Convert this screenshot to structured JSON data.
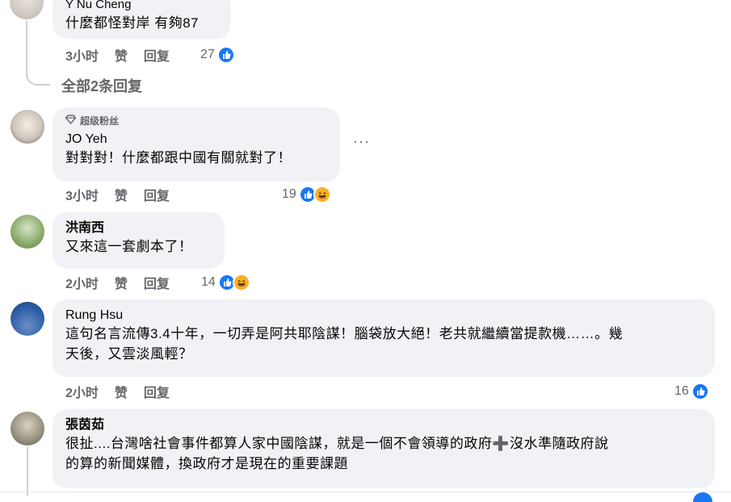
{
  "comments": [
    {
      "author": "Y Nu Cheng",
      "text": "什麼都怪對岸 有夠87",
      "time": "3小时",
      "like_label": "赞",
      "reply_label": "回复",
      "reaction_count": "27",
      "reactions": [
        "like"
      ]
    },
    {
      "author": "JO Yeh",
      "badge": "超级粉丝",
      "badge_icon": "diamond-icon",
      "text": "對對對！什麼都跟中國有關就對了！",
      "time": "3小时",
      "like_label": "赞",
      "reply_label": "回复",
      "reaction_count": "19",
      "reactions": [
        "like",
        "haha"
      ],
      "more_label": "···"
    },
    {
      "author": "洪南西",
      "text": "又來這一套劇本了！",
      "time": "2小时",
      "like_label": "赞",
      "reply_label": "回复",
      "reaction_count": "14",
      "reactions": [
        "like",
        "haha"
      ]
    },
    {
      "author": "Rung Hsu",
      "text": "這句名言流傳3.4十年，一切弄是阿共耶陰謀！腦袋放大絕！老共就繼續當提款機……。幾\n天後，又雲淡風輕？",
      "time": "2小时",
      "like_label": "赞",
      "reply_label": "回复",
      "reaction_count": "16",
      "reactions": [
        "like"
      ]
    },
    {
      "author": "張茵茹",
      "text": "很扯....台灣啥社會事件都算人家中國陰謀，就是一個不會領導的政府➕沒水準隨政府說\n的算的新聞媒體，換政府才是現在的重要課題"
    }
  ],
  "view_replies_label": "全部2条回复",
  "colors": {
    "bubble": "#f0f2f5",
    "secondary_text": "#65676b",
    "like_blue": "#1877f2",
    "haha_yellow": "#f7b125"
  }
}
